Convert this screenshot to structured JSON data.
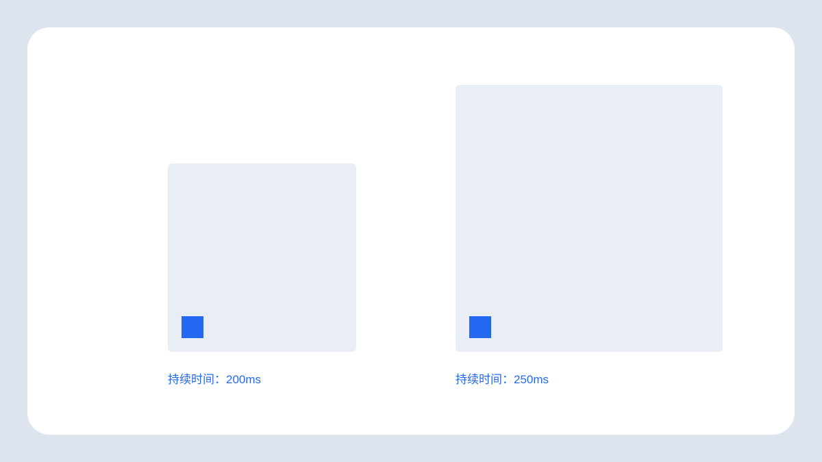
{
  "colors": {
    "page_bg": "#dde4ed",
    "card_bg": "#ffffff",
    "box_bg": "#e9eef5",
    "accent": "#2468f2"
  },
  "demos": [
    {
      "size": "small",
      "duration_label": "持续时间：200ms"
    },
    {
      "size": "large",
      "duration_label": "持续时间：250ms"
    }
  ]
}
